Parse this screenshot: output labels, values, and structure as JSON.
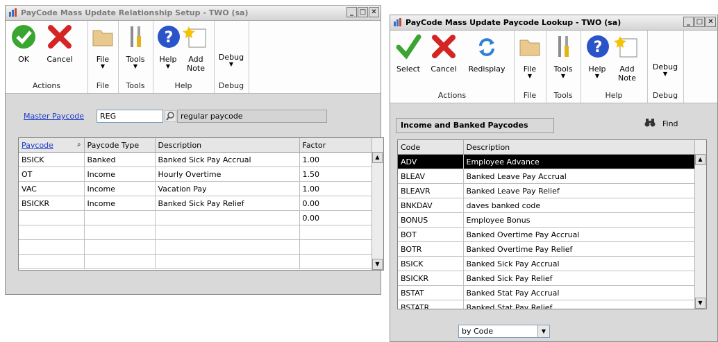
{
  "win1": {
    "title": "PayCode Mass Update Relationship Setup  -  TWO (sa)",
    "window_buttons": [
      "_",
      "□",
      "✕"
    ],
    "ribbon": {
      "ok": "OK",
      "cancel": "Cancel",
      "file": "File",
      "tools": "Tools",
      "help": "Help",
      "add": "Add",
      "note": "Note",
      "debug": "Debug",
      "groups": {
        "actions": "Actions",
        "file": "File",
        "tools": "Tools",
        "help": "Help",
        "debug": "Debug"
      }
    },
    "master_label": "Master Paycode",
    "master_value": "REG",
    "master_desc": "regular paycode",
    "columns": [
      "Paycode",
      "Paycode Type",
      "Description",
      "Factor"
    ],
    "rows": [
      [
        "BSICK",
        "Banked",
        "Banked Sick Pay Accrual",
        "1.00"
      ],
      [
        "OT",
        "Income",
        "Hourly Overtime",
        "1.50"
      ],
      [
        "VAC",
        "Income",
        "Vacation Pay",
        "1.00"
      ],
      [
        "BSICKR",
        "Income",
        "Banked Sick Pay Relief",
        "0.00"
      ],
      [
        "",
        "",
        "",
        "0.00"
      ],
      [
        "",
        "",
        "",
        ""
      ],
      [
        "",
        "",
        "",
        ""
      ],
      [
        "",
        "",
        "",
        ""
      ]
    ]
  },
  "win2": {
    "title": "PayCode Mass Update Paycode Lookup  -  TWO (sa)",
    "window_buttons": [
      "_",
      "□",
      "✕"
    ],
    "ribbon": {
      "select": "Select",
      "cancel": "Cancel",
      "redisplay": "Redisplay",
      "file": "File",
      "tools": "Tools",
      "help": "Help",
      "add": "Add",
      "note": "Note",
      "debug": "Debug",
      "groups": {
        "actions": "Actions",
        "file": "File",
        "tools": "Tools",
        "help": "Help",
        "debug": "Debug"
      }
    },
    "panel_title": "Income and Banked Paycodes",
    "find_label": "Find",
    "columns": [
      "Code",
      "Description"
    ],
    "rows": [
      [
        "ADV",
        "Employee Advance"
      ],
      [
        "BLEAV",
        "Banked Leave Pay Accrual"
      ],
      [
        "BLEAVR",
        "Banked Leave Pay Relief"
      ],
      [
        "BNKDAV",
        "daves banked code"
      ],
      [
        "BONUS",
        "Employee Bonus"
      ],
      [
        "BOT",
        "Banked Overtime Pay Accrual"
      ],
      [
        "BOTR",
        "Banked Overtime Pay Relief"
      ],
      [
        "BSICK",
        "Banked Sick Pay Accrual"
      ],
      [
        "BSICKR",
        "Banked Sick Pay Relief"
      ],
      [
        "BSTAT",
        "Banked Stat Pay Accrual"
      ],
      [
        "BSTATR",
        "Banked Stat Pay Relief"
      ]
    ],
    "sort_value": "by Code"
  },
  "colors": {
    "link": "#1a39c9",
    "ok_green": "#3aa531",
    "cancel_red": "#d42424",
    "help_blue": "#2a54c8",
    "redisplay_blue": "#2d7fd8",
    "selected_row": "#000000"
  },
  "icons": [
    "app-icon",
    "ok-check-icon",
    "cancel-x-icon",
    "folder-icon",
    "tools-icon",
    "help-icon",
    "add-note-icon",
    "lookup-icon",
    "redisplay-icon",
    "binoculars-icon"
  ]
}
